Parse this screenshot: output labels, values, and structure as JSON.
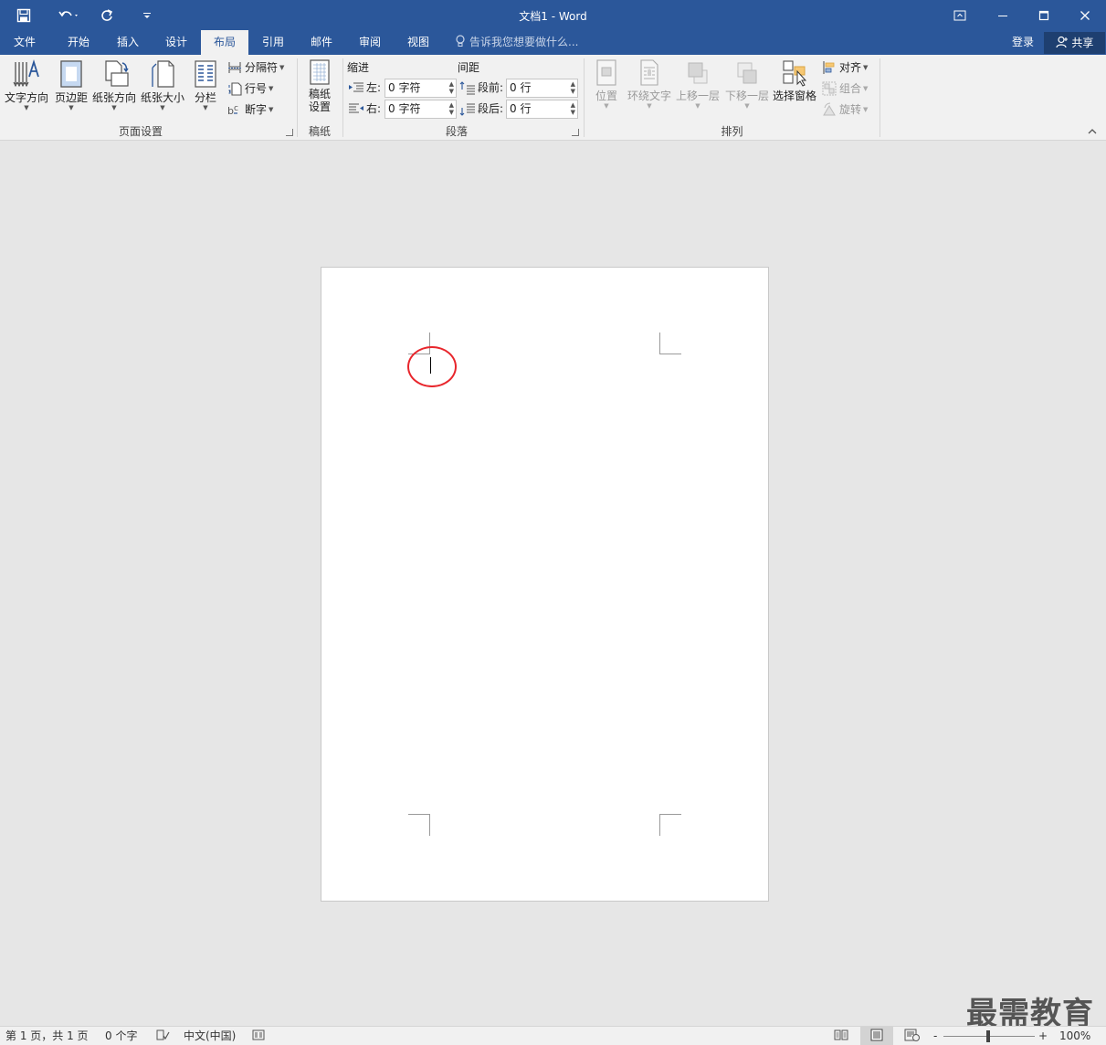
{
  "window": {
    "title": "文档1 - Word"
  },
  "qat": {
    "save": "save-icon",
    "undo": "undo-icon",
    "redo": "redo-icon",
    "customize": "customize-icon"
  },
  "tabs": [
    {
      "label": "文件"
    },
    {
      "label": "开始"
    },
    {
      "label": "插入"
    },
    {
      "label": "设计"
    },
    {
      "label": "布局",
      "active": true
    },
    {
      "label": "引用"
    },
    {
      "label": "邮件"
    },
    {
      "label": "审阅"
    },
    {
      "label": "视图"
    }
  ],
  "tellme": "告诉我您想要做什么...",
  "account": {
    "login": "登录",
    "share": "共享"
  },
  "ribbon": {
    "page_setup": {
      "group_label": "页面设置",
      "text_direction": "文字方向",
      "margins": "页边距",
      "orientation": "纸张方向",
      "size": "纸张大小",
      "columns": "分栏",
      "breaks": "分隔符",
      "line_numbers": "行号",
      "hyphenation": "断字"
    },
    "manuscript": {
      "group_label": "稿纸",
      "button_line1": "稿纸",
      "button_line2": "设置"
    },
    "paragraph": {
      "group_label": "段落",
      "indent_label": "缩进",
      "spacing_label": "间距",
      "left_label": "左:",
      "right_label": "右:",
      "left_value": "0 字符",
      "right_value": "0 字符",
      "before_label": "段前:",
      "after_label": "段后:",
      "before_value": "0 行",
      "after_value": "0 行"
    },
    "arrange": {
      "group_label": "排列",
      "position": "位置",
      "wrap_text": "环绕文字",
      "bring_forward": "上移一层",
      "send_backward": "下移一层",
      "selection_pane": "选择窗格",
      "align": "对齐",
      "group": "组合",
      "rotate": "旋转"
    }
  },
  "status": {
    "page": "第 1 页，共 1 页",
    "words": "0 个字",
    "language": "中文(中国)",
    "zoom": "100%",
    "zoom_minus": "-",
    "zoom_plus": "+"
  },
  "watermark": "最需教育",
  "colors": {
    "accent": "#2b579a",
    "annotation_ring": "#e8262c"
  }
}
